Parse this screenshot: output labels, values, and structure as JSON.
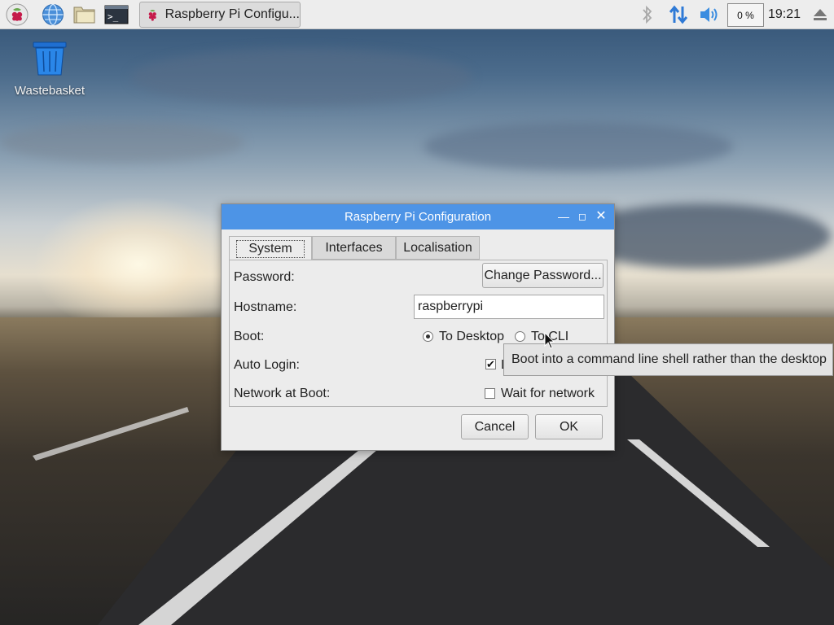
{
  "taskbar": {
    "launchers": [
      {
        "icon": "raspberry-menu-icon"
      },
      {
        "icon": "web-browser-icon"
      },
      {
        "icon": "file-manager-icon"
      },
      {
        "icon": "terminal-icon"
      }
    ],
    "window_button_label": "Raspberry Pi Configu...",
    "cpu_usage": "0 %",
    "clock": "19:21",
    "tray_icons": [
      "bluetooth-icon",
      "network-icon",
      "volume-icon",
      "eject-icon"
    ]
  },
  "desktop": {
    "icons": [
      {
        "label": "Wastebasket",
        "icon": "trash-icon"
      }
    ]
  },
  "dialog": {
    "title": "Raspberry Pi Configuration",
    "tabs": [
      {
        "label": "System",
        "active": true
      },
      {
        "label": "Interfaces",
        "active": false
      },
      {
        "label": "Localisation",
        "active": false
      }
    ],
    "rows": {
      "password": {
        "label": "Password:",
        "button_label": "Change Password..."
      },
      "hostname": {
        "label": "Hostname:",
        "value": "raspberrypi"
      },
      "boot": {
        "label": "Boot:",
        "options": [
          "To Desktop",
          "To CLI"
        ],
        "selected": "To Desktop"
      },
      "auto_login": {
        "label": "Auto Login:",
        "option_label": "L",
        "checked": true
      },
      "network_at_boot": {
        "label": "Network at Boot:",
        "option_label": "Wait for network",
        "checked": false
      }
    },
    "buttons": {
      "cancel": "Cancel",
      "ok": "OK"
    }
  },
  "tooltip": {
    "text": "Boot into a command line shell rather than the desktop"
  },
  "colors": {
    "titlebar": "#4d94e6",
    "dialog_bg": "#ececec",
    "taskbar_bg": "#ededed"
  }
}
